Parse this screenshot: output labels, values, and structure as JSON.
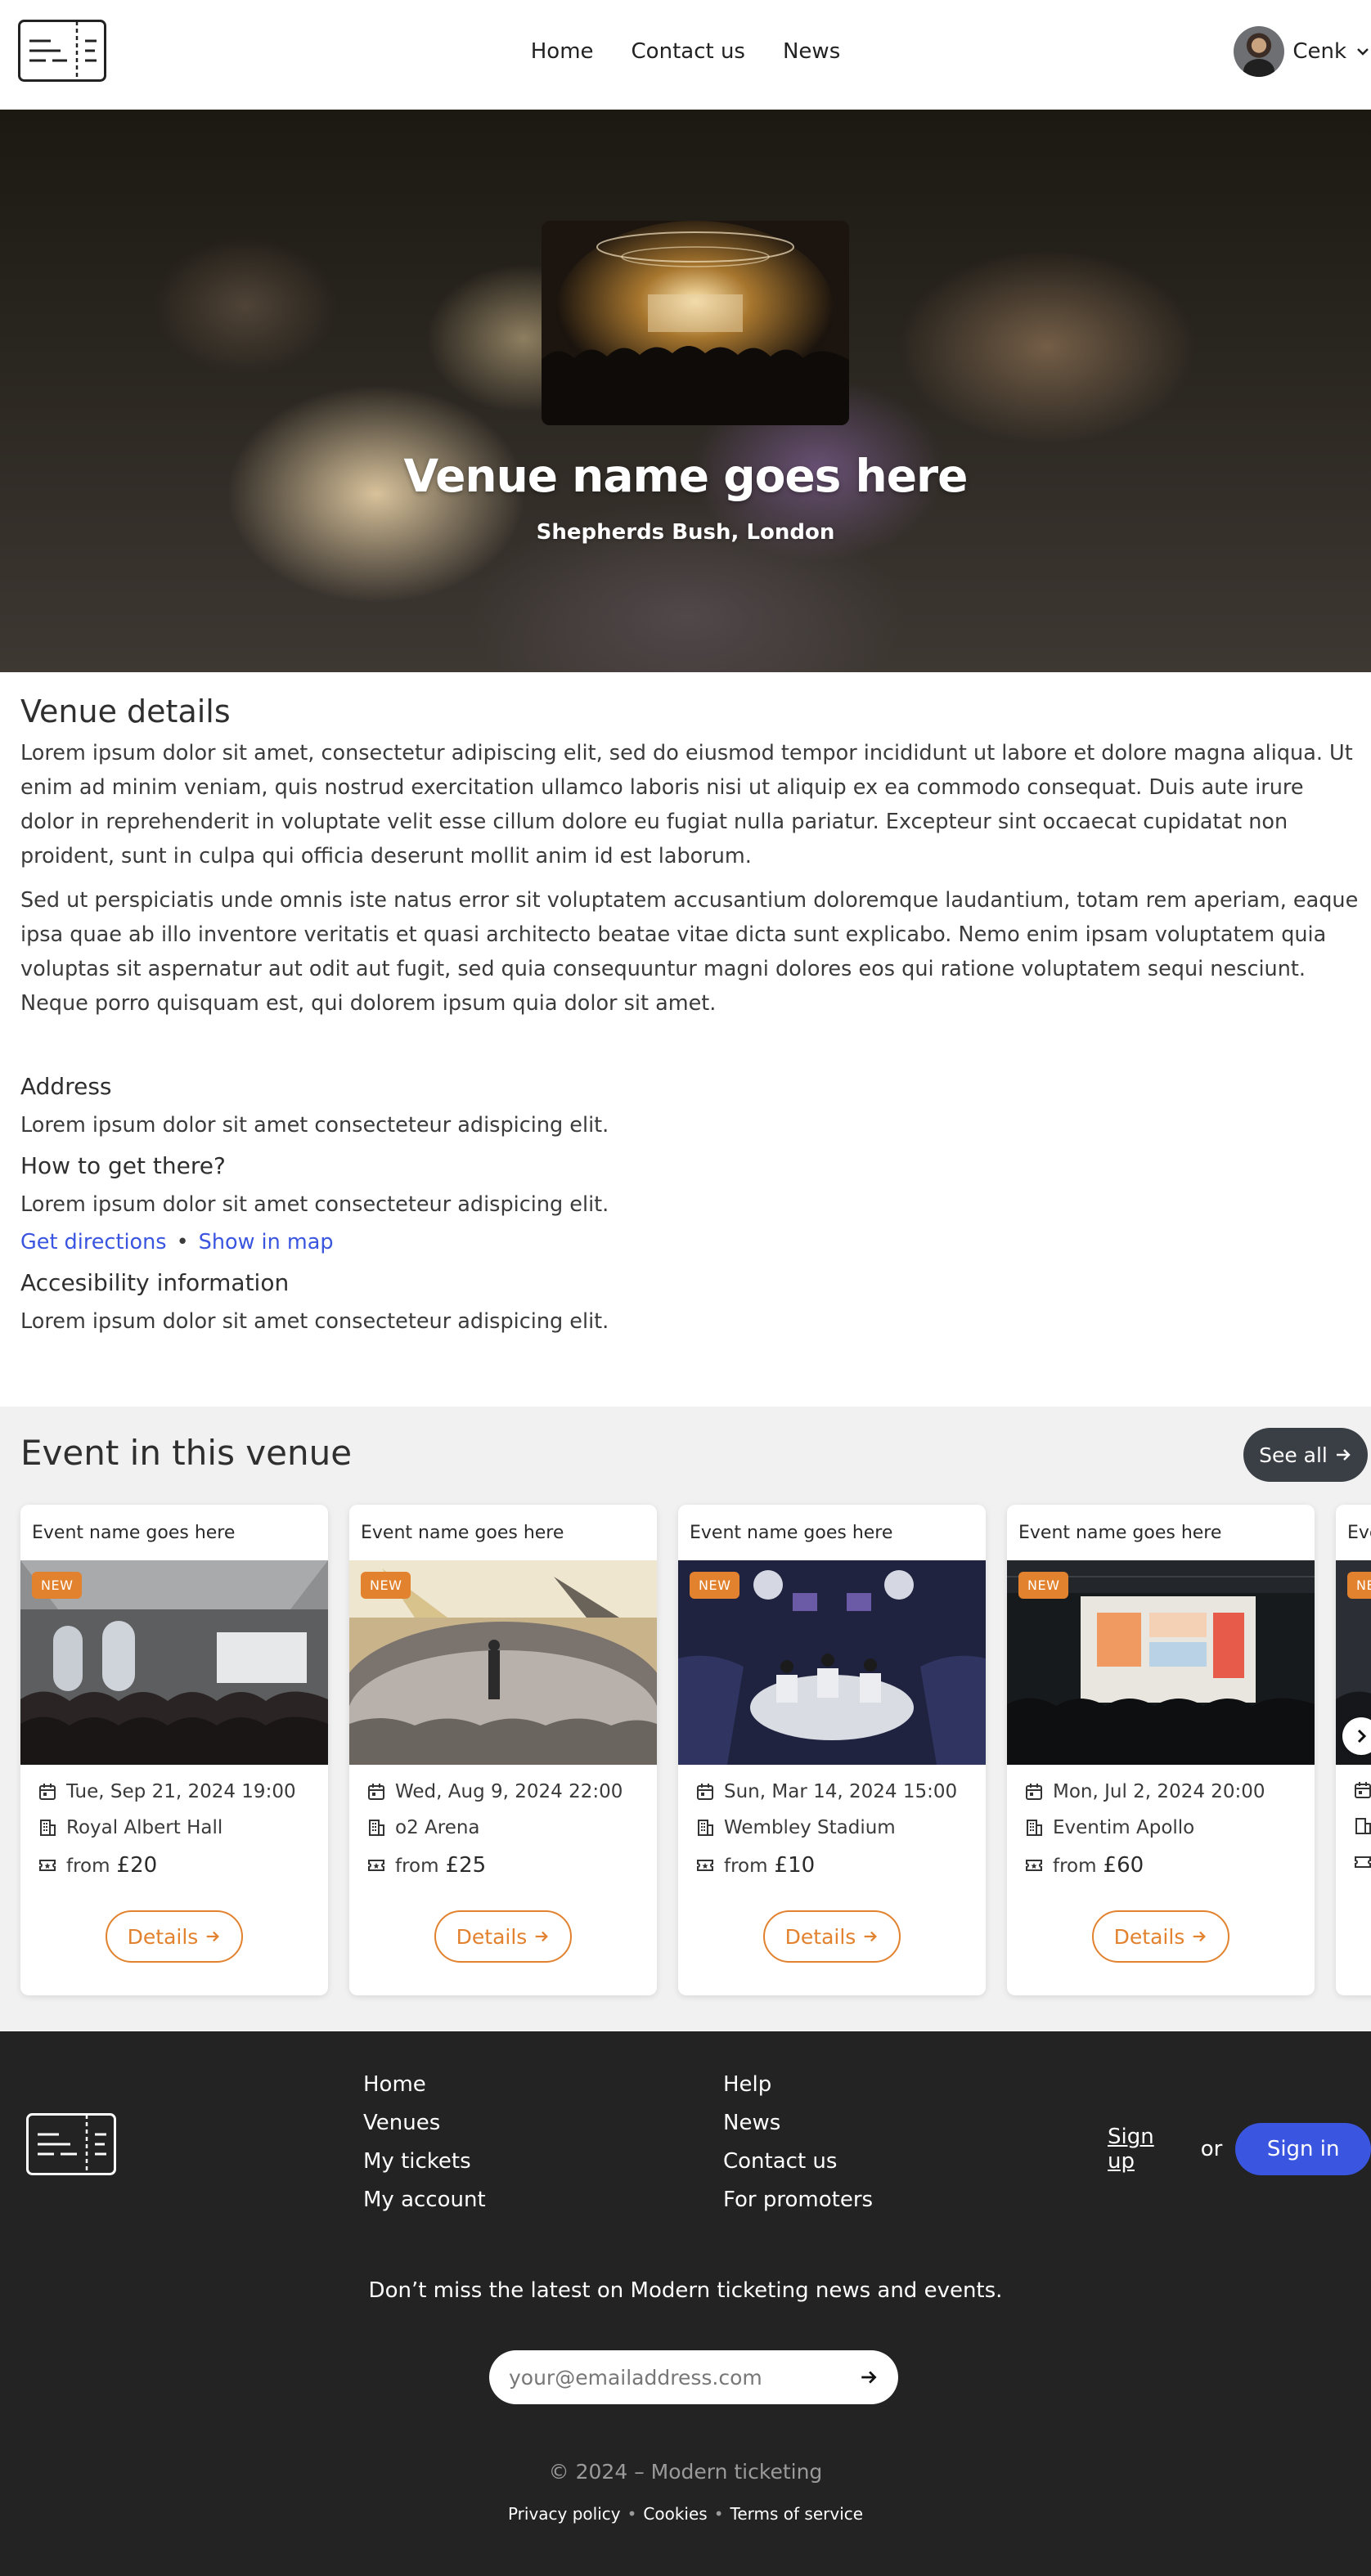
{
  "nav": {
    "links": [
      "Home",
      "Contact us",
      "News"
    ],
    "user_name": "Cenk"
  },
  "hero": {
    "title": "Venue name goes here",
    "subtitle": "Shepherds Bush, London"
  },
  "venue": {
    "heading": "Venue details",
    "description": [
      "Lorem ipsum dolor sit amet, consectetur adipiscing elit, sed do eiusmod tempor incididunt ut labore et dolore magna aliqua. Ut enim ad minim veniam, quis nostrud exercitation ullamco laboris nisi ut aliquip ex ea commodo consequat. Duis aute irure dolor in reprehenderit in voluptate velit esse cillum dolore eu fugiat nulla pariatur. Excepteur sint occaecat cupidatat non proident, sunt in culpa qui officia deserunt mollit anim id est laborum.",
      "Sed ut perspiciatis unde omnis iste natus error sit voluptatem accusantium doloremque laudantium, totam rem aperiam, eaque ipsa quae ab illo inventore veritatis et quasi architecto beatae vitae dicta sunt explicabo. Nemo enim ipsam voluptatem quia voluptas sit aspernatur aut odit aut fugit, sed quia consequuntur magni dolores eos qui ratione voluptatem sequi nesciunt. Neque porro quisquam est, qui dolorem ipsum quia dolor sit amet."
    ],
    "address_heading": "Address",
    "address_text": "Lorem ipsum dolor sit amet consecteteur adispicing elit.",
    "howto_heading": "How to get there?",
    "howto_text": "Lorem ipsum dolor sit amet consecteteur adispicing elit.",
    "directions_link": "Get directions",
    "link_separator": "•",
    "map_link": "Show in map",
    "access_heading": "Accesibility information",
    "access_text": "Lorem ipsum dolor sit amet consecteteur adispicing elit."
  },
  "events": {
    "heading": "Event in this venue",
    "see_all": "See all",
    "badge": "NEW",
    "from_label": "from",
    "details_label": "Details",
    "items": [
      {
        "name": "Event name goes here",
        "date": "Tue, Sep 21, 2024 19:00",
        "venue": "Royal Albert Hall",
        "price": "£20"
      },
      {
        "name": "Event name goes here",
        "date": "Wed, Aug 9, 2024 22:00",
        "venue": "o2 Arena",
        "price": "£25"
      },
      {
        "name": "Event name goes here",
        "date": "Sun, Mar 14, 2024 15:00",
        "venue": "Wembley Stadium",
        "price": "£10"
      },
      {
        "name": "Event name goes here",
        "date": "Mon, Jul 2, 2024 20:00",
        "venue": "Eventim Apollo",
        "price": "£60"
      },
      {
        "name": "Event name goes here",
        "date": "",
        "venue": "",
        "price": ""
      }
    ]
  },
  "footer": {
    "col1": [
      "Home",
      "Venues",
      "My tickets",
      "My account"
    ],
    "col2": [
      "Help",
      "News",
      "Contact us",
      "For promoters"
    ],
    "signup": "Sign up",
    "or": "or",
    "signin": "Sign in",
    "newsletter": "Don’t miss the latest on Modern ticketing news and events.",
    "email_placeholder": "your@emailaddress.com",
    "copyright": "© 2024 – Modern ticketing",
    "legal": [
      "Privacy policy",
      "Cookies",
      "Terms of service"
    ],
    "legal_separator": "•"
  },
  "colors": {
    "accent_orange": "#e2822e",
    "primary_blue": "#3a55e0",
    "footer_bg": "#232323",
    "events_bg": "#f1f1f1"
  },
  "icons": [
    "logo-icon",
    "chevron-down-icon",
    "arrow-right-icon",
    "calendar-icon",
    "building-icon",
    "ticket-icon",
    "chevron-right-icon"
  ]
}
